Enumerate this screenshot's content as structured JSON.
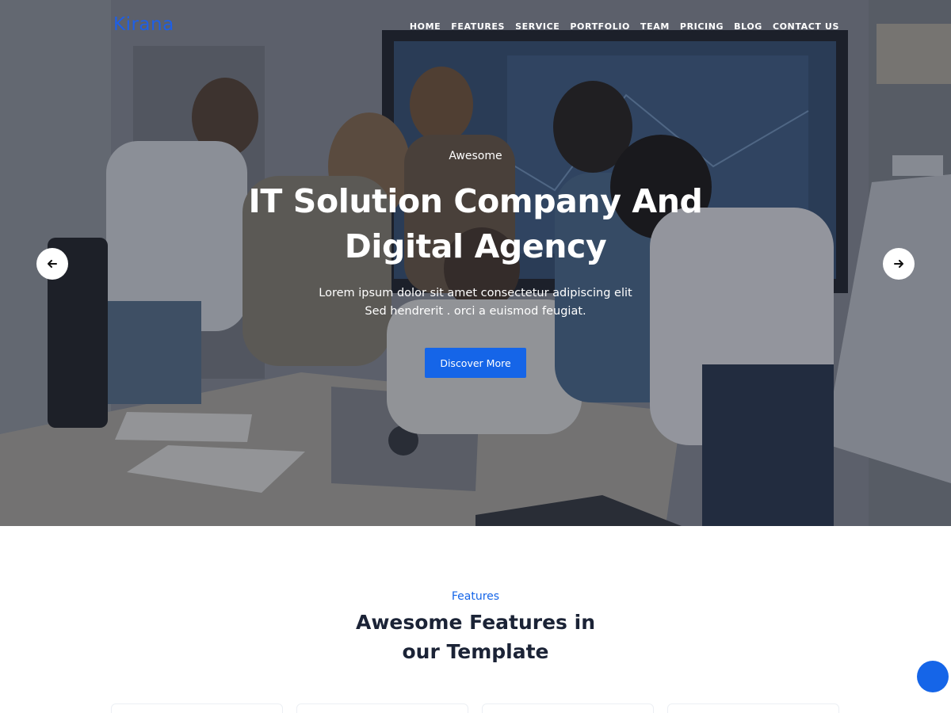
{
  "brand": {
    "logo": "Kirana"
  },
  "nav": {
    "items": [
      {
        "label": "HOME"
      },
      {
        "label": "FEATURES"
      },
      {
        "label": "SERVICE"
      },
      {
        "label": "PORTFOLIO"
      },
      {
        "label": "TEAM"
      },
      {
        "label": "PRICING"
      },
      {
        "label": "BLOG"
      },
      {
        "label": "CONTACT US"
      }
    ]
  },
  "hero": {
    "eyebrow": "Awesome",
    "title": "IT Solution Company And Digital Agency",
    "subtitle_line1": "Lorem ipsum dolor sit amet consectetur adipiscing elit",
    "subtitle_line2": "Sed hendrerit . orci a euismod feugiat.",
    "cta_label": "Discover More",
    "prev_icon": "arrow-left-icon",
    "next_icon": "arrow-right-icon"
  },
  "features": {
    "label": "Features",
    "title_line1": "Awesome Features in",
    "title_line2": "our Template"
  },
  "colors": {
    "accent": "#1565e8",
    "heading": "#1b2336",
    "overlay": "#12162266"
  }
}
